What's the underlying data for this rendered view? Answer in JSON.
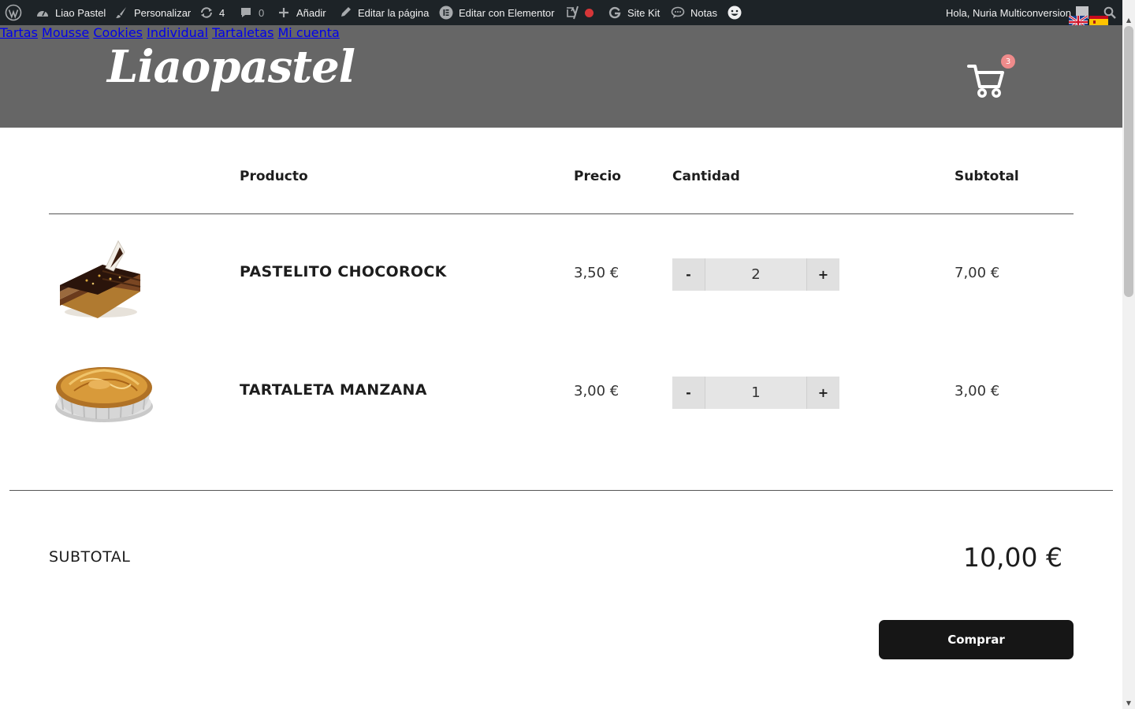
{
  "admin_bar": {
    "site_name": "Liao Pastel",
    "customize": "Personalizar",
    "updates_count": "4",
    "comments_count": "0",
    "add_new": "Añadir",
    "edit_page": "Editar la página",
    "edit_elementor": "Editar con Elementor",
    "site_kit": "Site Kit",
    "notes": "Notas",
    "greeting": "Hola, Nuria Multiconversion"
  },
  "header": {
    "logo_text": "Liaopastel",
    "nav": [
      {
        "label": "Tartas"
      },
      {
        "label": "Mousse"
      },
      {
        "label": "Cookies"
      },
      {
        "label": "Individual"
      },
      {
        "label": "Tartaletas"
      },
      {
        "label": "Mi cuenta"
      }
    ],
    "cart_count": "3"
  },
  "cart": {
    "headers": {
      "product": "Producto",
      "price": "Precio",
      "quantity": "Cantidad",
      "subtotal": "Subtotal"
    },
    "items": [
      {
        "name": "PASTELITO CHOCOROCK",
        "price": "3,50 €",
        "qty": "2",
        "subtotal": "7,00 €",
        "image": "chocolate-cake-slice"
      },
      {
        "name": "TARTALETA MANZANA",
        "price": "3,00 €",
        "qty": "1",
        "subtotal": "3,00 €",
        "image": "apple-tart"
      }
    ],
    "minus_label": "-",
    "plus_label": "+",
    "totals_label": "SUBTOTAL",
    "totals_value": "10,00 €",
    "buy_label": "Comprar"
  },
  "colors": {
    "admin_bar": "#1d2327",
    "header": "#666666",
    "button": "#161616",
    "badge": "#ef8b8b"
  }
}
